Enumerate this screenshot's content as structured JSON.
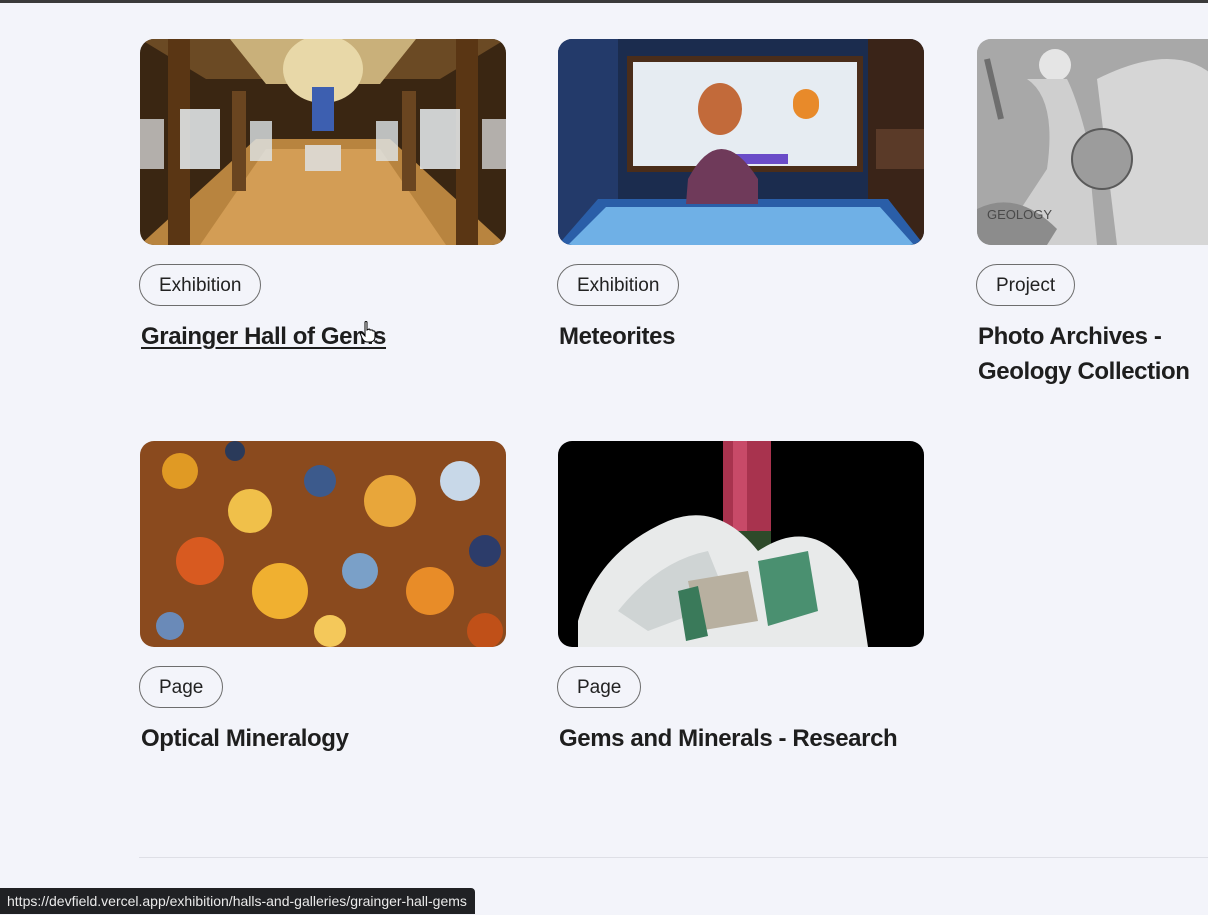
{
  "cards": [
    {
      "tag": "Exhibition",
      "title": "Grainger Hall of Gems",
      "image": "gem-hall-gallery"
    },
    {
      "tag": "Exhibition",
      "title": "Meteorites",
      "image": "meteorite-display-touch-table"
    },
    {
      "tag": "Project",
      "title": "Photo Archives - Geology Collection",
      "image": "geology-relief-sculpture"
    },
    {
      "tag": "Page",
      "title": "Optical Mineralogy",
      "image": "thin-section-micrograph"
    },
    {
      "tag": "Page",
      "title": "Gems and Minerals - Research",
      "image": "tourmaline-crystal-specimen"
    }
  ],
  "status_url": "https://devfield.vercel.app/exhibition/halls-and-galleries/grainger-hall-gems",
  "colors": {
    "background": "#f3f4fa",
    "text": "#1e1e1e",
    "tag_border": "#6d6d6d",
    "status_bg": "#202124"
  }
}
